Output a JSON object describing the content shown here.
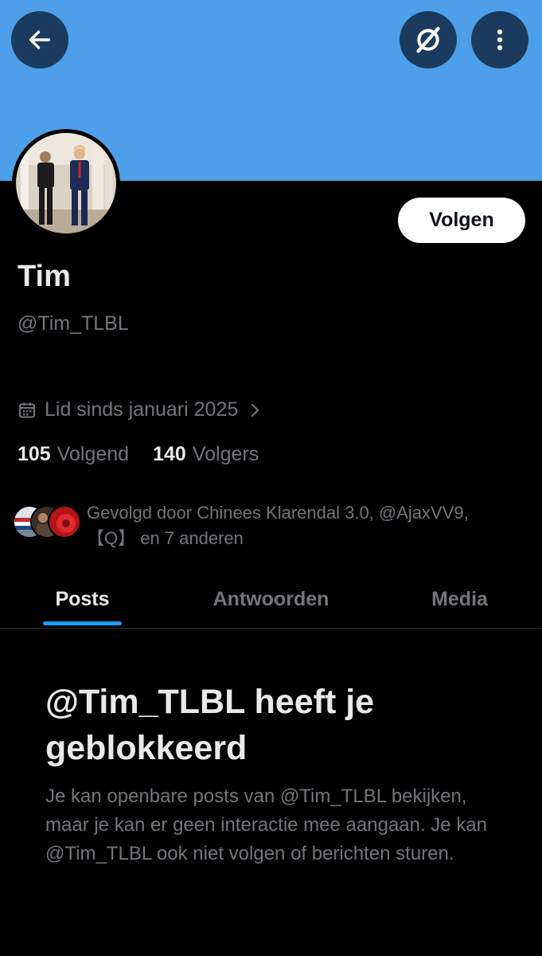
{
  "colors": {
    "banner": "#4d9fe9",
    "accent": "#1d9bf0",
    "background": "#000000",
    "primary_text": "#e7e9ea",
    "secondary_text": "#71767b"
  },
  "header": {
    "back_icon": "arrow-left-icon",
    "grok_icon": "grok-icon",
    "more_icon": "more-vertical-icon"
  },
  "profile": {
    "display_name": "Tim",
    "handle": "@Tim_TLBL",
    "follow_label": "Volgen",
    "joined": "Lid sinds januari 2025",
    "following_count": "105",
    "following_label": "Volgend",
    "followers_count": "140",
    "followers_label": "Volgers",
    "followed_by_line1": "Gevolgd door Chinees Klarendal 3.0, @AjaxVV9,",
    "followed_by_line2": "【Q】 en 7 anderen"
  },
  "tabs": [
    {
      "label": "Posts",
      "active": true
    },
    {
      "label": "Antwoorden",
      "active": false
    },
    {
      "label": "Media",
      "active": false
    }
  ],
  "blocked": {
    "title": "@Tim_TLBL heeft je geblokkeerd",
    "body": "Je kan openbare posts van @Tim_TLBL bekijken, maar je kan er geen interactie mee aangaan. Je kan @Tim_TLBL ook niet volgen of berichten sturen."
  }
}
